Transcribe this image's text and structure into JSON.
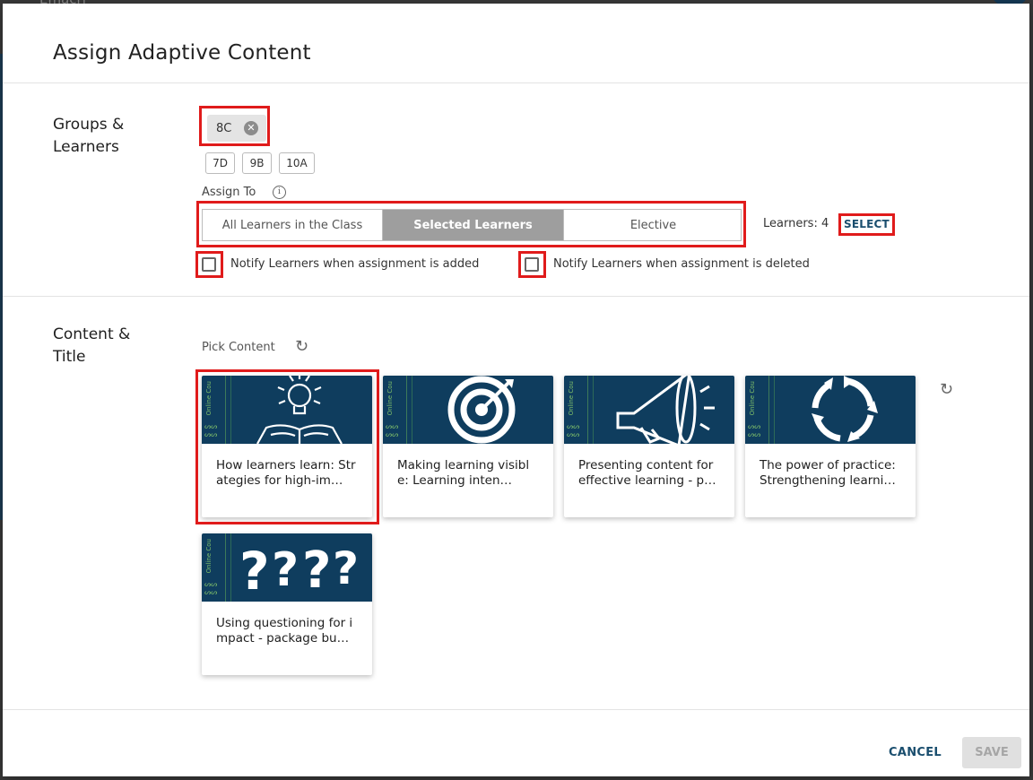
{
  "backdrop": {
    "partial_text": "Emacri"
  },
  "dialog": {
    "title": "Assign Adaptive Content"
  },
  "groups": {
    "label": "Groups & Learners",
    "selected_chip": "8C",
    "chips": [
      "7D",
      "9B",
      "10A"
    ]
  },
  "assign": {
    "label": "Assign To",
    "info_icon": "info-icon",
    "options": [
      "All Learners in the Class",
      "Selected Learners",
      "Elective"
    ],
    "active_option": "Selected Learners",
    "learners_count": "Learners: 4",
    "select_label": "SELECT"
  },
  "notify": {
    "added": {
      "label": "Notify Learners when assignment is added",
      "checked": false
    },
    "deleted": {
      "label": "Notify Learners when assignment is deleted",
      "checked": false
    }
  },
  "content": {
    "label": "Content & Title",
    "pick_label": "Pick Content",
    "cards": [
      {
        "title": "How learners learn: Strategies for high-im…",
        "icon": "lightbulb-book-icon",
        "strip_text": "Online Cou"
      },
      {
        "title": "Making learning visible: Learning inten…",
        "icon": "target-icon",
        "strip_text": "Online Cou"
      },
      {
        "title": "Presenting content for effective learning - p…",
        "icon": "megaphone-icon",
        "strip_text": "Online Cou"
      },
      {
        "title": "The power of practice: Strengthening learnin…",
        "icon": "cycle-arrows-icon",
        "strip_text": "Online Cou"
      },
      {
        "title": "Using questioning for impact - package bu…",
        "icon": "question-marks-icon",
        "strip_text": "Online Cou"
      }
    ]
  },
  "footer": {
    "cancel_label": "CANCEL",
    "save_label": "SAVE"
  },
  "colors": {
    "accent": "#1a4e6e",
    "highlight": "#e01b1b",
    "card_bg": "#0f3d5e",
    "segment_active": "#9e9e9e"
  }
}
